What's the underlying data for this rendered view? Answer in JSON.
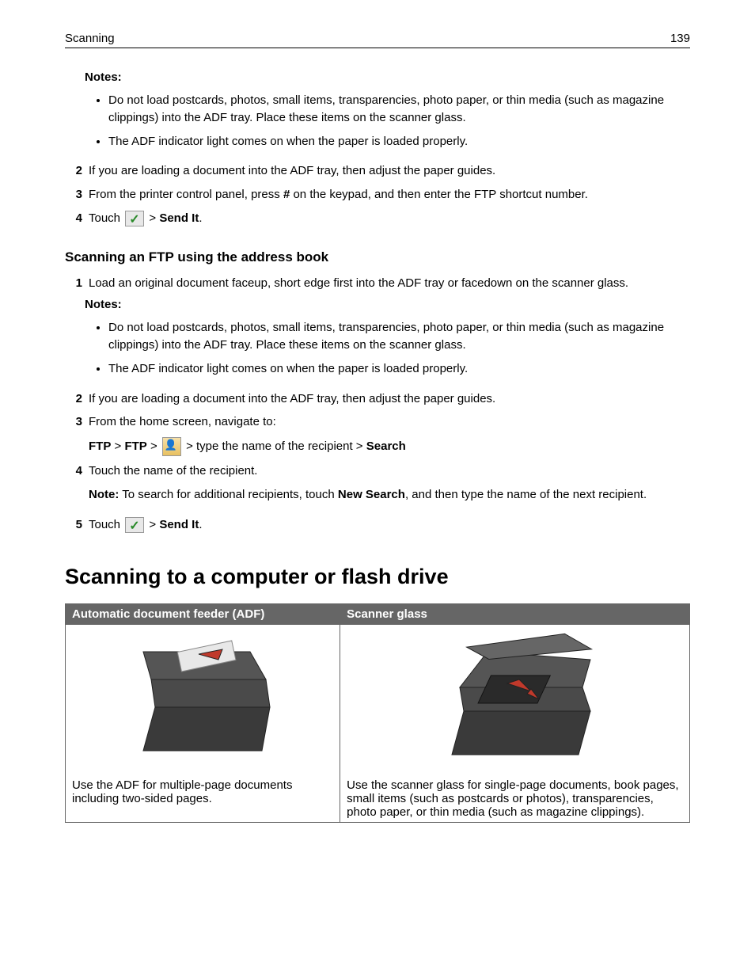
{
  "header": {
    "section": "Scanning",
    "page_number": "139"
  },
  "section1": {
    "notes_label": "Notes:",
    "note_items": [
      "Do not load postcards, photos, small items, transparencies, photo paper, or thin media (such as magazine clippings) into the ADF tray. Place these items on the scanner glass.",
      "The ADF indicator light comes on when the paper is loaded properly."
    ],
    "step2": {
      "num": "2",
      "text": "If you are loading a document into the ADF tray, then adjust the paper guides."
    },
    "step3": {
      "num": "3",
      "pre": "From the printer control panel, press ",
      "key": "#",
      "post": " on the keypad, and then enter the FTP shortcut number."
    },
    "step4": {
      "num": "4",
      "touch": "Touch ",
      "gt": " > ",
      "send_it": "Send It",
      "period": "."
    }
  },
  "section2": {
    "heading": "Scanning an FTP using the address book",
    "step1": {
      "num": "1",
      "text": "Load an original document faceup, short edge first into the ADF tray or facedown on the scanner glass."
    },
    "notes_label": "Notes:",
    "note_items": [
      "Do not load postcards, photos, small items, transparencies, photo paper, or thin media (such as magazine clippings) into the ADF tray. Place these items on the scanner glass.",
      "The ADF indicator light comes on when the paper is loaded properly."
    ],
    "step2": {
      "num": "2",
      "text": "If you are loading a document into the ADF tray, then adjust the paper guides."
    },
    "step3": {
      "num": "3",
      "text": "From the home screen, navigate to:"
    },
    "step3_path": {
      "ftp1": "FTP",
      "gt1": " > ",
      "ftp2": "FTP",
      "gt2": " > ",
      "gt3": "  > ",
      "type_text": "type the name of the recipient",
      "gt4": " > ",
      "search": "Search"
    },
    "step4": {
      "num": "4",
      "text": "Touch the name of the recipient."
    },
    "step4_note": {
      "label": "Note:",
      "pre": " To search for additional recipients, touch ",
      "new_search": "New Search",
      "post": ", and then type the name of the next recipient."
    },
    "step5": {
      "num": "5",
      "touch": "Touch ",
      "gt": " > ",
      "send_it": "Send It",
      "period": "."
    }
  },
  "major_heading": "Scanning to a computer or flash drive",
  "table": {
    "th1": "Automatic document feeder (ADF)",
    "th2": "Scanner glass",
    "td1": "Use the ADF for multiple‑page documents including two‑sided pages.",
    "td2": "Use the scanner glass for single‑page documents, book pages, small items (such as postcards or photos), transparencies, photo paper, or thin media (such as magazine clippings)."
  }
}
